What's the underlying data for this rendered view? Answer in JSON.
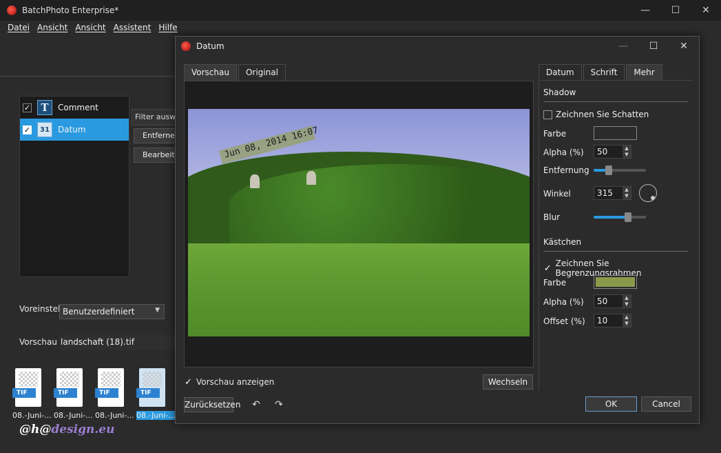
{
  "app": {
    "title": "BatchPhoto Enterprise*",
    "window_controls": [
      "—",
      "☐",
      "✕"
    ]
  },
  "menu": [
    "Datei",
    "Ansicht",
    "Ansicht",
    "Assistent",
    "Hilfe"
  ],
  "filters": [
    {
      "label": "Comment",
      "checked": true,
      "icon": "text-icon",
      "glyph": "T"
    },
    {
      "label": "Datum",
      "checked": true,
      "icon": "calendar-icon",
      "glyph": "31"
    }
  ],
  "side_buttons": {
    "filter_select": "Filter auswä",
    "remove": "Entferner",
    "edit": "Bearbeiter"
  },
  "preset": {
    "label": "Voreinstell",
    "value": "Benutzerdefiniert"
  },
  "preview_file": {
    "label": "Vorschau",
    "value": "landschaft (18).tif"
  },
  "thumbnails": [
    {
      "caption": "08.-Juni-...",
      "tag": "TIF",
      "selected": false
    },
    {
      "caption": "08.-Juni-...",
      "tag": "TIF",
      "selected": false
    },
    {
      "caption": "08.-Juni-...",
      "tag": "TIF",
      "selected": false
    },
    {
      "caption": "08.-Juni-...",
      "tag": "TIF",
      "selected": true
    }
  ],
  "watermark": {
    "part_a": "@h@",
    "part_b": "design.eu"
  },
  "dialog": {
    "title": "Datum",
    "tabs_left": [
      "Vorschau",
      "Original"
    ],
    "active_tab_left": "Vorschau",
    "date_overlay": "Jun 08, 2014 16:07",
    "show_preview_label": "Vorschau anzeigen",
    "show_preview_checked": true,
    "switch_button": "Wechseln",
    "reset_button": "Zurücksetzen",
    "undo_icon": "undo-arrow-icon",
    "redo_icon": "redo-arrow-icon",
    "ok_button": "OK",
    "cancel_button": "Cancel",
    "tabs_right": [
      "Datum",
      "Schrift",
      "Mehr"
    ],
    "active_tab_right": "Mehr",
    "shadow": {
      "section_title": "Shadow",
      "draw_label": "Zeichnen Sie Schatten",
      "draw_checked": false,
      "color_label": "Farbe",
      "color": "#2b2b2b",
      "alpha_label": "Alpha (%)",
      "alpha_value": "50",
      "distance_label": "Entfernung",
      "distance_level": 0.3,
      "angle_label": "Winkel",
      "angle_value": "315",
      "blur_label": "Blur",
      "blur_level": 0.65
    },
    "box": {
      "section_title": "Kästchen",
      "draw_label": "Zeichnen Sie Begrenzungsrahmen",
      "draw_checked": true,
      "color_label": "Farbe",
      "color": "#8a9a4a",
      "alpha_label": "Alpha (%)",
      "alpha_value": "50",
      "offset_label": "Offset (%)",
      "offset_value": "10"
    }
  }
}
